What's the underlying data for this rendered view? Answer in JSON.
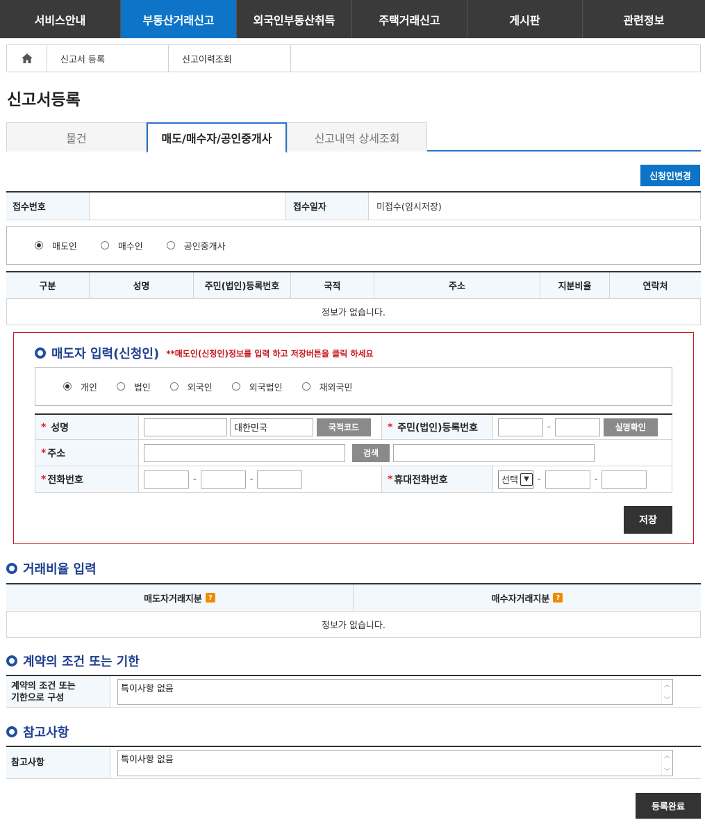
{
  "nav": {
    "items": [
      {
        "label": "서비스안내"
      },
      {
        "label": "부동산거래신고"
      },
      {
        "label": "외국인부동산취득"
      },
      {
        "label": "주택거래신고"
      },
      {
        "label": "게시판"
      },
      {
        "label": "관련정보"
      }
    ],
    "active_index": 1,
    "active_color": "#0d74c8"
  },
  "breadcrumb": {
    "home_icon": "home-icon",
    "items": [
      "신고서 등록",
      "신고이력조회"
    ]
  },
  "page": {
    "title": "신고서등록"
  },
  "tabs": {
    "items": [
      "물건",
      "매도/매수자/공인중개사",
      "신고내역 상세조회"
    ],
    "active_index": 1
  },
  "actions": {
    "change_applicant": "신청인변경"
  },
  "receipt": {
    "number_label": "접수번호",
    "number_value": "",
    "date_label": "접수일자",
    "date_value": "미접수(임시저장)"
  },
  "party_type": {
    "options": [
      "매도인",
      "매수인",
      "공인중개사"
    ],
    "selected": "매도인"
  },
  "party_table": {
    "headers": [
      "구분",
      "성명",
      "주민(법인)등록번호",
      "국적",
      "주소",
      "지분비율",
      "연락처"
    ],
    "empty_text": "정보가 없습니다."
  },
  "seller_form": {
    "title": "매도자 입력(신청인)",
    "note": "**매도인(신청인)정보를 입력 하고 저장버튼을 클릭 하세요",
    "person_types": [
      "개인",
      "법인",
      "외국인",
      "외국법인",
      "재외국민"
    ],
    "selected_type": "개인",
    "name_label": "성명",
    "name_value": "",
    "nationality_value": "대한민국",
    "nationality_button": "국적코드",
    "reg_no_label": "주민(법인)등록번호",
    "reg_no_1": "",
    "reg_no_2": "",
    "verify_button": "실명확인",
    "address_label": "주소",
    "address_value": "",
    "search_button": "검색",
    "address_detail": "",
    "phone_label": "전화번호",
    "phone": [
      "",
      "",
      ""
    ],
    "mobile_label": "휴대전화번호",
    "mobile_select": "선택",
    "mobile": [
      "",
      ""
    ],
    "save_button": "저장",
    "accent_color": "#c8171e"
  },
  "ratio": {
    "title": "거래비율 입력",
    "headers": [
      "매도자거래지분",
      "매수자거래지분"
    ],
    "help_icon": "?",
    "empty_text": "정보가 없습니다."
  },
  "conditions": {
    "title": "계약의 조건 또는 기한",
    "label_line1": "계약의 조건 또는",
    "label_line2": "기한으로 구성",
    "value": "특이사항 없음"
  },
  "notes": {
    "title": "참고사항",
    "label": "참고사항",
    "value": "특이사항 없음"
  },
  "footer": {
    "complete_button": "등록완료"
  }
}
